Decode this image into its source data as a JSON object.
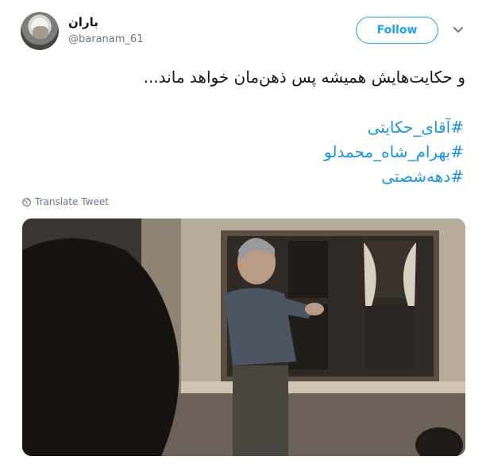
{
  "user": {
    "display_name": "باران",
    "handle": "@baranam_61"
  },
  "actions": {
    "follow_label": "Follow"
  },
  "tweet": {
    "text": "و حکایت‌هایش همیشه پس ذهن‌مان خواهد ماند...",
    "hashtags": [
      "#آقای_حکایتی",
      "#بهرام_شاه_محمدلو",
      "#دهه‌شصتی"
    ],
    "translate_label": "Translate Tweet"
  },
  "colors": {
    "accent": "#1da1f2",
    "hashtag": "#1b95e0",
    "secondary_text": "#657786"
  },
  "icons": {
    "translate": "globe-icon",
    "menu": "chevron-down-icon"
  }
}
